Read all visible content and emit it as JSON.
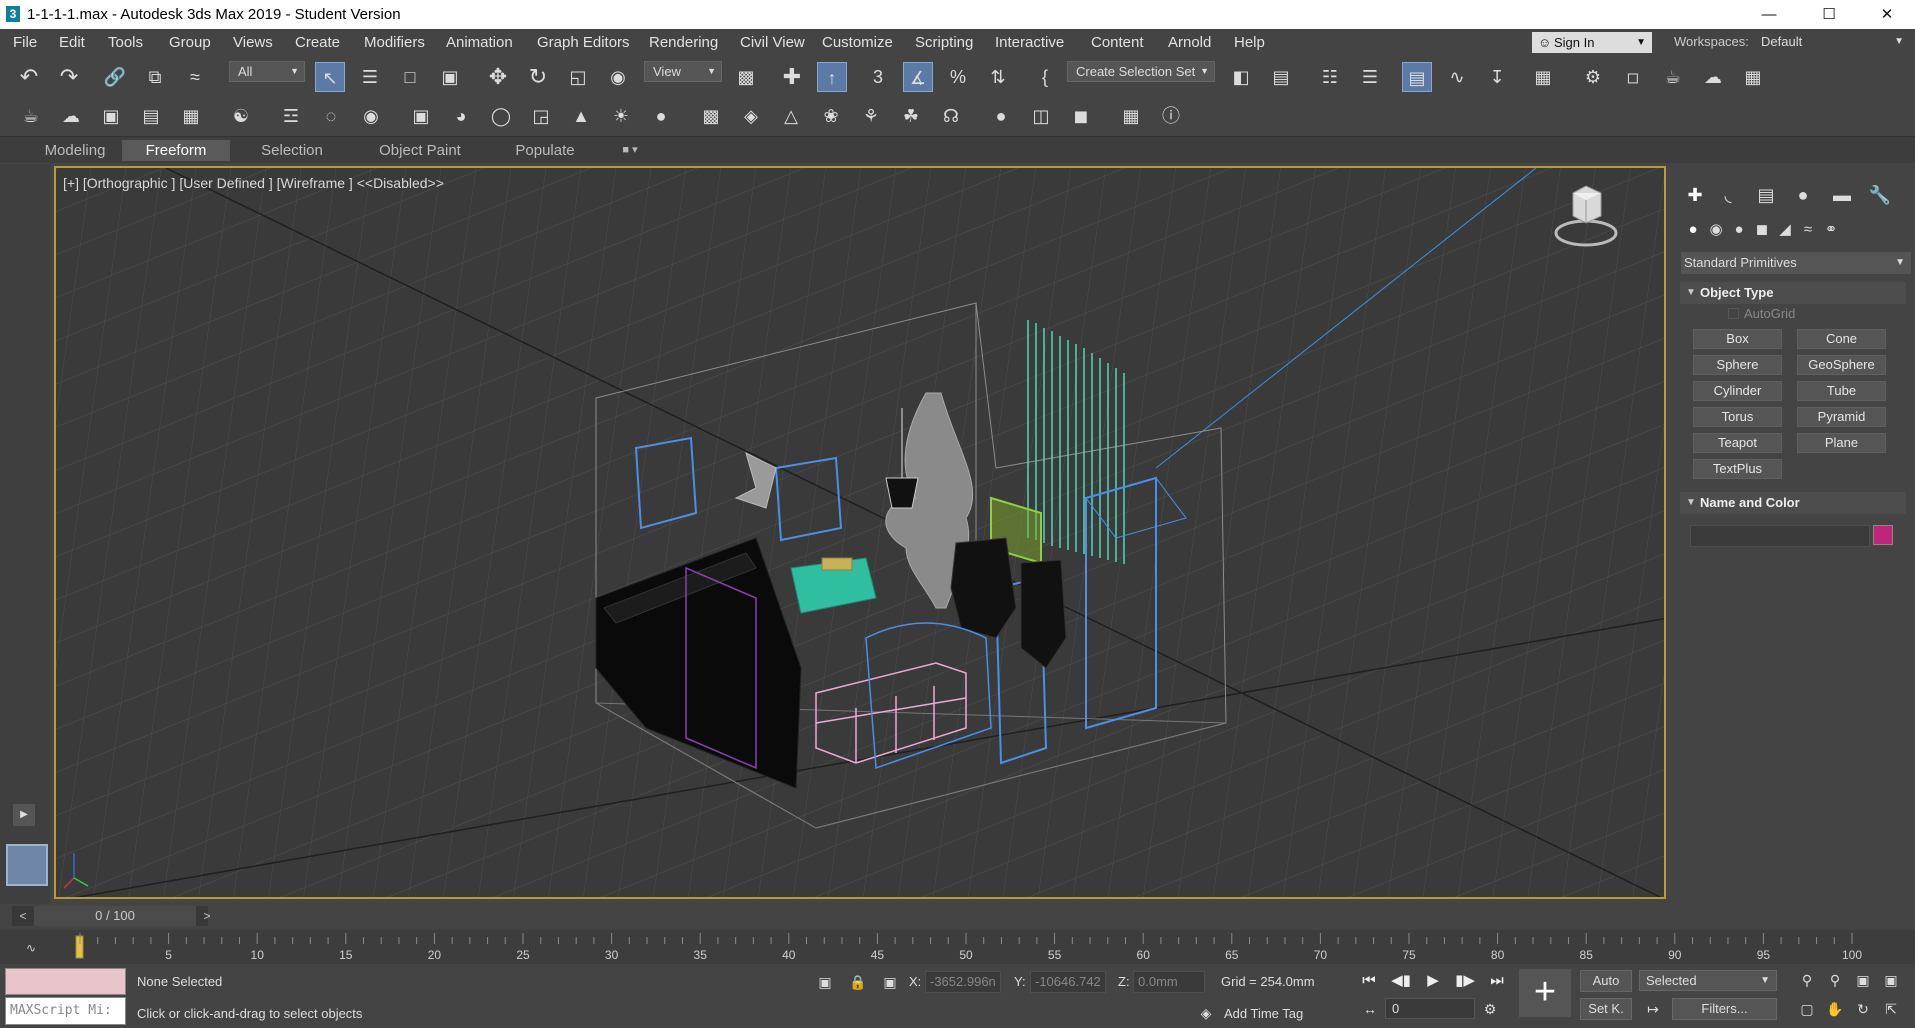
{
  "window": {
    "title": "1-1-1-1.max - Autodesk 3ds Max 2019 - Student Version",
    "app_icon_glyph": "3",
    "minimize_glyph": "—",
    "maximize_glyph": "☐",
    "close_glyph": "✕"
  },
  "menu": {
    "items": [
      "File",
      "Edit",
      "Tools",
      "Group",
      "Views",
      "Create",
      "Modifiers",
      "Animation",
      "Graph Editors",
      "Rendering",
      "Civil View",
      "Customize",
      "Scripting",
      "Interactive",
      "Content",
      "Arnold",
      "Help"
    ],
    "sign_in": "Sign In",
    "workspaces_label": "Workspaces:",
    "workspace_value": "Default"
  },
  "toolbar": {
    "selection_filter": "All",
    "ref_coord": "View",
    "selection_set_placeholder": "Create Selection Set"
  },
  "ribbon": {
    "tabs": [
      "Modeling",
      "Freeform",
      "Selection",
      "Object Paint",
      "Populate"
    ],
    "active_tab": "Freeform"
  },
  "viewport": {
    "label": "[+] [Orthographic ] [User Defined ] [Wireframe ]  <<Disabled>>",
    "border_color": "#b99b3c"
  },
  "command_panel": {
    "category": "Standard Primitives",
    "object_type_title": "Object Type",
    "autogrid": "AutoGrid",
    "primitives": [
      "Box",
      "Cone",
      "Sphere",
      "GeoSphere",
      "Cylinder",
      "Tube",
      "Torus",
      "Pyramid",
      "Teapot",
      "Plane",
      "TextPlus"
    ],
    "name_color_title": "Name and Color",
    "object_color": "#c0257a"
  },
  "timeline": {
    "time_slider": "0 / 100",
    "prev": "<",
    "next": ">",
    "ticks": [
      "5",
      "10",
      "15",
      "20",
      "25",
      "30",
      "35",
      "40",
      "45",
      "50",
      "55",
      "60",
      "65",
      "70",
      "75",
      "80",
      "85",
      "90",
      "95",
      "100"
    ]
  },
  "status": {
    "maxscript_label": "MAXScript Mi:",
    "selection": "None Selected",
    "prompt": "Click or click-and-drag to select objects",
    "x_label": "X:",
    "x_value": "-3652.996n",
    "y_label": "Y:",
    "y_value": "-10646.742",
    "z_label": "Z:",
    "z_value": "0.0mm",
    "grid": "Grid = 254.0mm",
    "add_time_tag": "Add Time Tag",
    "auto_key": "Auto",
    "set_key": "Set K.",
    "key_filter": "Selected",
    "filters": "Filters...",
    "current_frame": "0"
  }
}
